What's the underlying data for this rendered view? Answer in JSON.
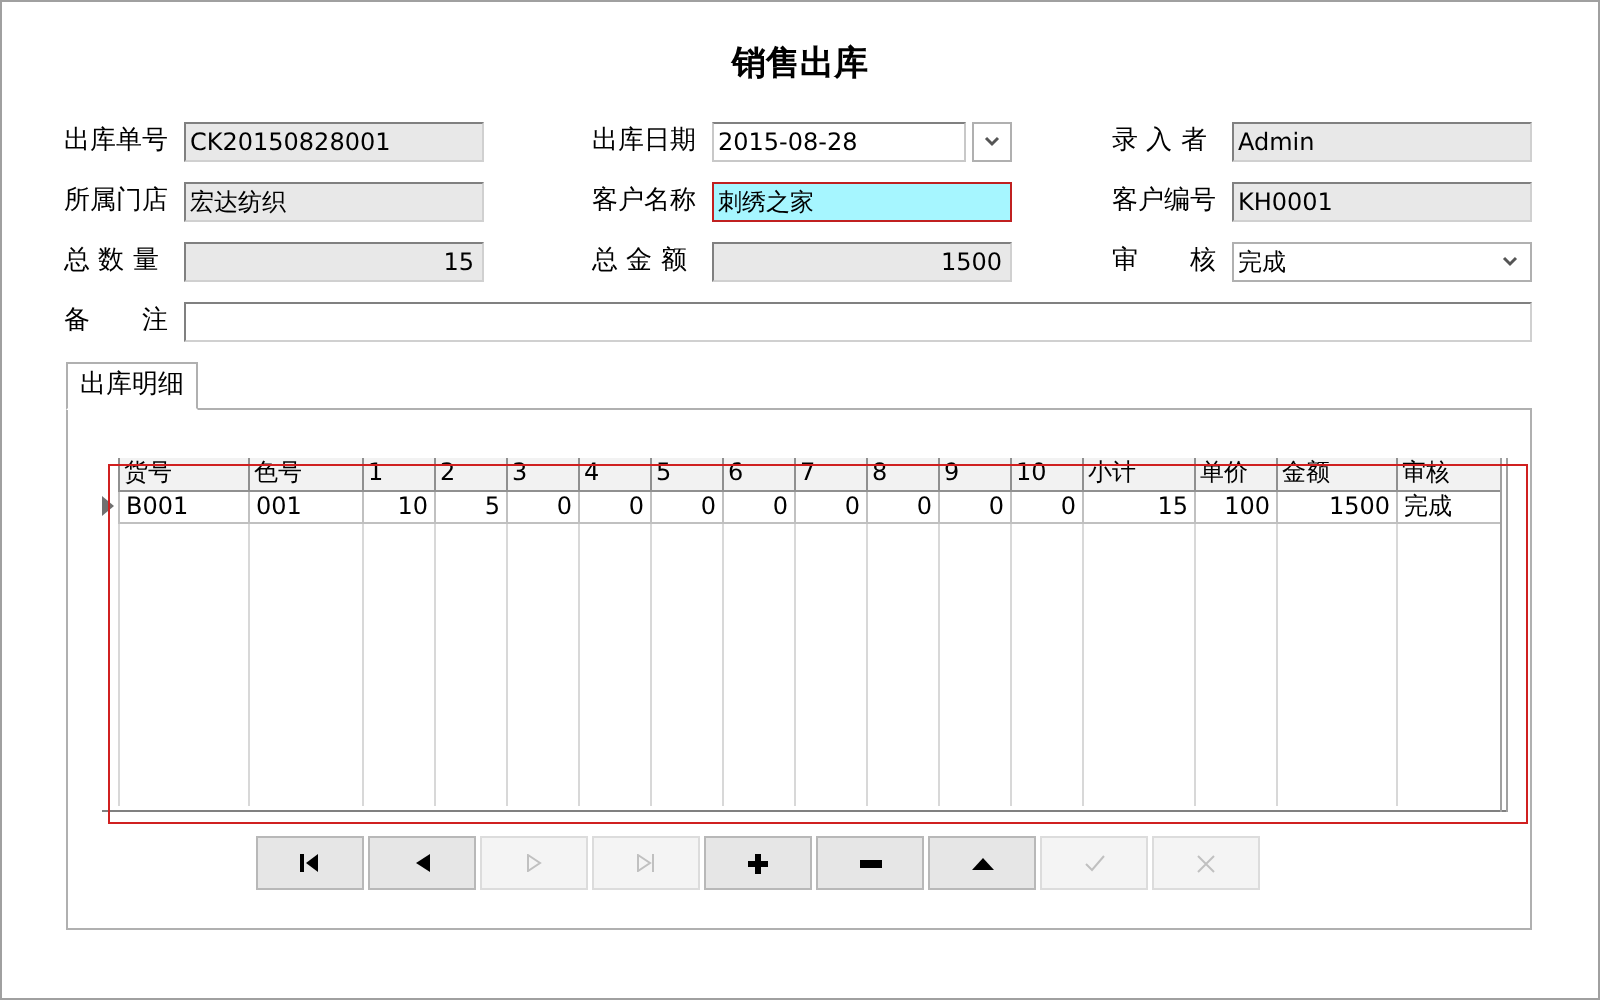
{
  "window": {
    "title": "销售出库"
  },
  "fields": [
    [
      {
        "label": "出库单号",
        "value": "CK20150828001",
        "kind": "readonly"
      },
      {
        "label": "出库日期",
        "value": "2015-08-28",
        "kind": "date"
      },
      {
        "label": "录 入 者",
        "value": "Admin",
        "kind": "readonly"
      }
    ],
    [
      {
        "label": "所属门店",
        "value": "宏达纺织",
        "kind": "readonly"
      },
      {
        "label": "客户名称",
        "value": "刺绣之家",
        "kind": "focused"
      },
      {
        "label": "客户编号",
        "value": "KH0001",
        "kind": "readonly"
      }
    ],
    [
      {
        "label": "总 数 量",
        "value": "15",
        "kind": "readonly_number"
      },
      {
        "label": "总 金 额",
        "value": "1500",
        "kind": "readonly_number"
      },
      {
        "label": "审　　核",
        "value": "完成",
        "kind": "select"
      }
    ],
    [
      {
        "label": "备　　注",
        "kind": "wide"
      }
    ]
  ],
  "tabs": [
    {
      "label": "出库明细",
      "selected": true
    }
  ],
  "grid": {
    "columns": [
      "货号",
      "色号",
      "1",
      "2",
      "3",
      "4",
      "5",
      "6",
      "7",
      "8",
      "9",
      "10",
      "小计",
      "单价",
      "金额",
      "审核"
    ],
    "rows": [
      {
        "current": true,
        "cells": [
          "B001",
          "001",
          "10",
          "5",
          "0",
          "0",
          "0",
          "0",
          "0",
          "0",
          "0",
          "0",
          "15",
          "100",
          "1500",
          "完成"
        ]
      }
    ]
  },
  "nav_buttons": [
    {
      "kind": "first",
      "disabled": false
    },
    {
      "kind": "prev",
      "disabled": false
    },
    {
      "kind": "next",
      "disabled": true
    },
    {
      "kind": "last",
      "disabled": true
    },
    {
      "kind": "add",
      "disabled": false
    },
    {
      "kind": "remove",
      "disabled": false
    },
    {
      "kind": "edit",
      "disabled": false
    },
    {
      "kind": "post",
      "disabled": true
    },
    {
      "kind": "cancel",
      "disabled": true
    }
  ]
}
